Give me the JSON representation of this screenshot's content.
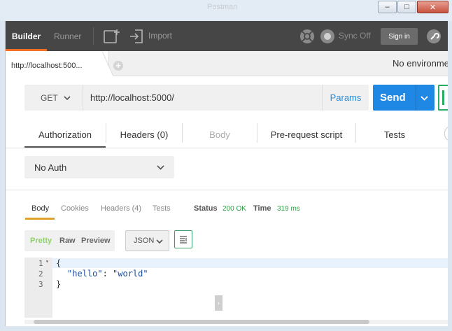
{
  "window": {
    "title": "Postman",
    "minimize": "–",
    "maximize": "□",
    "close": "✕"
  },
  "topbar": {
    "tab_builder": "Builder",
    "tab_runner": "Runner",
    "import": "Import",
    "sync": "Sync Off",
    "signin": "Sign in",
    "new_tab_icon": "new-tab-icon",
    "import_icon": "import-icon",
    "interceptor_icon": "interceptor-icon",
    "sync_icon": "sync-icon",
    "settings_icon": "settings-icon"
  },
  "request_tabs": {
    "current": "http://localhost:500...",
    "add": "+",
    "environment": "No environme"
  },
  "request": {
    "method": "GET",
    "url": "http://localhost:5000/",
    "params": "Params",
    "send": "Send"
  },
  "subtabs": [
    "Authorization",
    "Headers (0)",
    "Body",
    "Pre-request script",
    "Tests"
  ],
  "auth": {
    "type": "No Auth"
  },
  "response": {
    "tabs": [
      "Body",
      "Cookies",
      "Headers (4)",
      "Tests"
    ],
    "status_label": "Status",
    "status_value": "200 OK",
    "time_label": "Time",
    "time_value": "319 ms",
    "formats": [
      "Pretty",
      "Raw",
      "Preview"
    ],
    "lang": "JSON",
    "lines": [
      "1",
      "2",
      "3"
    ],
    "code_open": "{",
    "code_key": "\"hello\"",
    "code_colon": ": ",
    "code_value": "\"world\"",
    "code_close": "}"
  },
  "colors": {
    "accent": "#f47023",
    "send": "#1f88e5",
    "ok": "#2e9e46"
  }
}
